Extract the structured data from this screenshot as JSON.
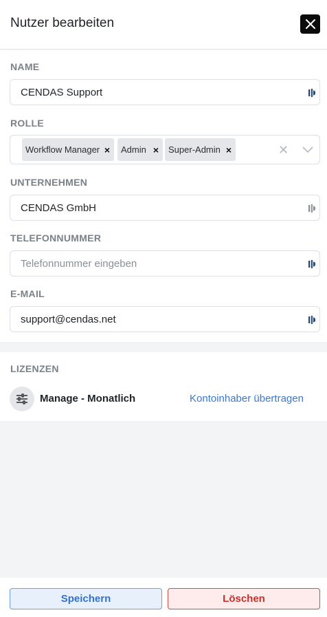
{
  "header": {
    "title": "Nutzer bearbeiten",
    "close_icon": "close-icon"
  },
  "fields": {
    "name": {
      "label": "NAME",
      "value": "CENDAS Support"
    },
    "role": {
      "label": "ROLLE",
      "tags": [
        "Workflow Manager",
        "Admin",
        "Super-Admin"
      ],
      "remove_glyph": "×",
      "clear_glyph": "✕"
    },
    "company": {
      "label": "UNTERNEHMEN",
      "value": "CENDAS GmbH"
    },
    "phone": {
      "label": "TELEFONNUMMER",
      "value": "",
      "placeholder": "Telefonnummer eingeben"
    },
    "email": {
      "label": "E-MAIL",
      "value": "support@cendas.net"
    }
  },
  "licenses": {
    "title": "LIZENZEN",
    "item": {
      "name": "Manage - Monatlich",
      "icon": "sliders-icon"
    },
    "transfer_link": "Kontoinhaber übertragen"
  },
  "footer": {
    "save_label": "Speichern",
    "delete_label": "Löschen"
  },
  "colors": {
    "accent": "#3472d0",
    "danger": "#c9302c",
    "label_gray": "#7b8189",
    "tag_bg": "#e4e6e9",
    "field_icon": "#2a4a7a"
  }
}
